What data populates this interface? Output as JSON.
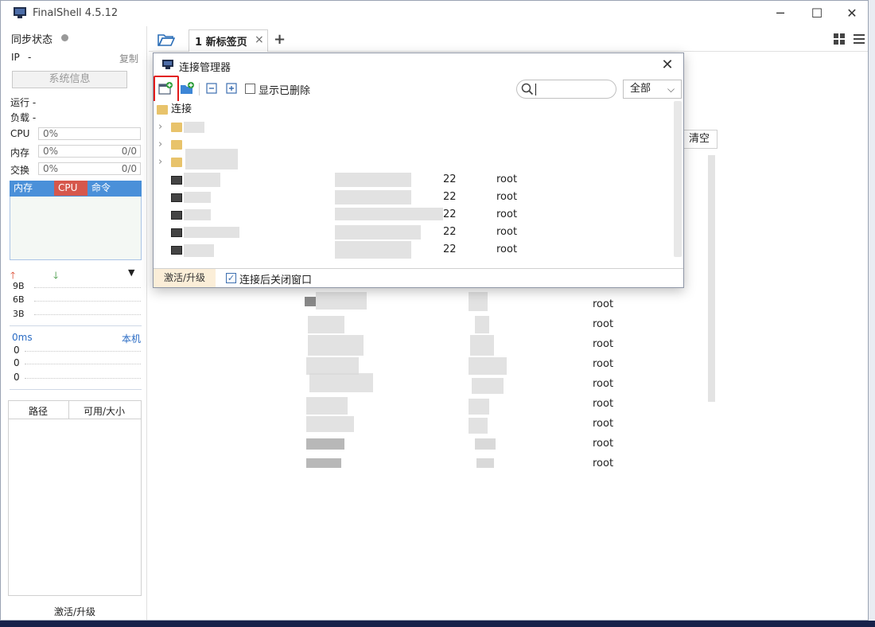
{
  "window": {
    "title": "FinalShell 4.5.12",
    "minimize": "─",
    "maximize": "☐",
    "close": "✕"
  },
  "sidebar": {
    "sync_label": "同步状态",
    "ip_label": "IP",
    "ip_value": "-",
    "copy": "复制",
    "sysinfo_button": "系统信息",
    "running": "运行 -",
    "load": "负载 -",
    "meters": [
      {
        "label": "CPU",
        "value": "0%",
        "extra": ""
      },
      {
        "label": "内存",
        "value": "0%",
        "extra": "0/0"
      },
      {
        "label": "交换",
        "value": "0%",
        "extra": "0/0"
      }
    ],
    "proc_tabs": [
      "内存",
      "CPU",
      "命令"
    ],
    "net_labels": [
      "9B",
      "6B",
      "3B"
    ],
    "latency": "0ms",
    "local": "本机",
    "latency_values": [
      "0",
      "0",
      "0"
    ],
    "disk_headers": [
      "路径",
      "可用/大小"
    ],
    "activate": "激活/升级"
  },
  "tabs": {
    "active_label": "1 新标签页",
    "close": "×",
    "add": "+"
  },
  "background": {
    "clear": "清空",
    "rows_user": [
      "root",
      "root",
      "root",
      "root",
      "root",
      "root",
      "root",
      "root",
      "root"
    ]
  },
  "dialog": {
    "title": "连接管理器",
    "close": "✕",
    "show_deleted": "显示已删除",
    "search_placeholder": "",
    "filter_value": "全部",
    "root_folder": "连接",
    "rows": [
      {
        "port": "22",
        "user": "root"
      },
      {
        "port": "22",
        "user": "root"
      },
      {
        "port": "22",
        "user": "root"
      },
      {
        "port": "22",
        "user": "root"
      },
      {
        "port": "22",
        "user": "root"
      }
    ],
    "activate": "激活/升级",
    "close_after_connect": "连接后关闭窗口",
    "close_after_connect_checked": true
  }
}
